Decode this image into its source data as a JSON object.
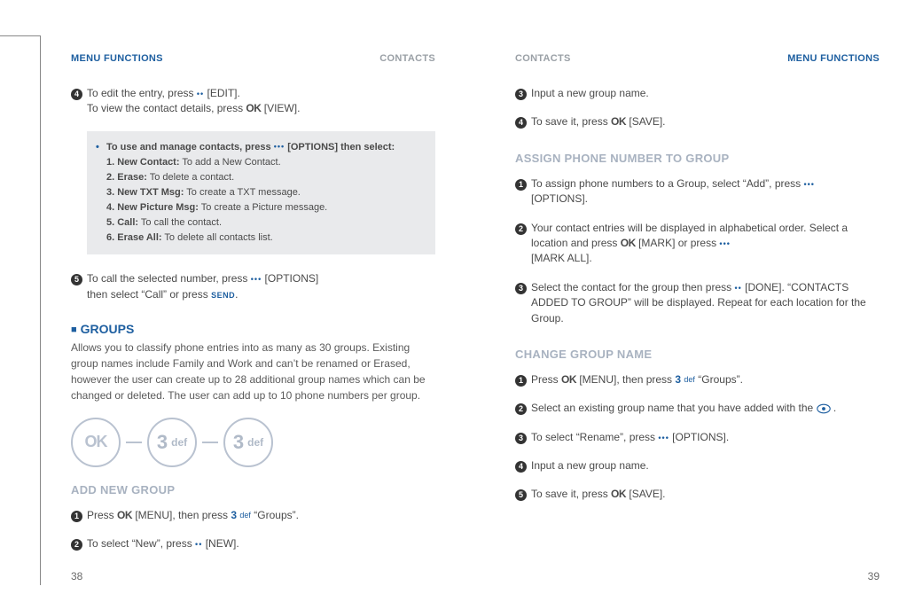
{
  "header": {
    "menu_functions": "MENU FUNCTIONS",
    "contacts": "CONTACTS"
  },
  "glyphs": {
    "ok": "OK",
    "two_dots": "••",
    "three_dots": "•••",
    "send": "SEND",
    "key3_num": "3",
    "key3_def": "def"
  },
  "left": {
    "step4_a": "To edit the entry, press ",
    "step4_b": "[EDIT].",
    "step4_c": "To view the contact details, press ",
    "step4_d": " [VIEW].",
    "box": {
      "lead_a": "To use and manage contacts, press ",
      "lead_b": " [OPTIONS] then select:",
      "i1_b": "1. New Contact:",
      "i1_t": " To add a New Contact.",
      "i2_b": "2. Erase:",
      "i2_t": " To delete a contact.",
      "i3_b": "3. New TXT Msg:",
      "i3_t": " To create a TXT message.",
      "i4_b": "4. New Picture Msg:",
      "i4_t": " To create a Picture message.",
      "i5_b": "5. Call:",
      "i5_t": " To call the contact.",
      "i6_b": "6. Erase All:",
      "i6_t": " To delete all contacts list."
    },
    "step5_a": "To call the selected number, press ",
    "step5_b": " [OPTIONS]",
    "step5_c": "then select “Call” or press ",
    "step5_d": ".",
    "groups_head": "GROUPS",
    "groups_para": "Allows you to classify phone entries into as many as 30 groups. Existing group names include Family and Work and can’t be renamed or Erased, however the user can create up to 28 additional group names which can be changed or deleted. The user can add up to 10 phone numbers per group.",
    "add_new_group": "ADD NEW GROUP",
    "ang1_a": "Press ",
    "ang1_b": " [MENU], then press ",
    "ang1_c": " “Groups”.",
    "ang2_a": "To select “New”, press ",
    "ang2_b": "[NEW]."
  },
  "right": {
    "step3": "Input a new group name.",
    "step4_a": "To save it, press ",
    "step4_b": " [SAVE].",
    "assign_head": "ASSIGN PHONE NUMBER TO GROUP",
    "a1_a": "To assign phone numbers to a Group, select “Add”, press ",
    "a1_b": "[OPTIONS].",
    "a2_a": "Your contact entries will be displayed in alphabetical order. Select a location and press ",
    "a2_b": " [MARK] or press ",
    "a2_c": "[MARK ALL].",
    "a3_a": "Select the contact for the group then press  ",
    "a3_b": "[DONE]. “CONTACTS ADDED TO GROUP” will be displayed. Repeat for each location for the Group.",
    "change_head": "CHANGE GROUP NAME",
    "c1_a": "Press ",
    "c1_b": " [MENU], then press ",
    "c1_c": " “Groups”.",
    "c2_a": "Select an existing group name that you have added with the  ",
    "c2_b": " .",
    "c3_a": "To select “Rename”, press ",
    "c3_b": " [OPTIONS].",
    "c4": "Input a new group name.",
    "c5_a": "To save it, press ",
    "c5_b": " [SAVE]."
  },
  "pagenums": {
    "left": "38",
    "right": "39"
  }
}
